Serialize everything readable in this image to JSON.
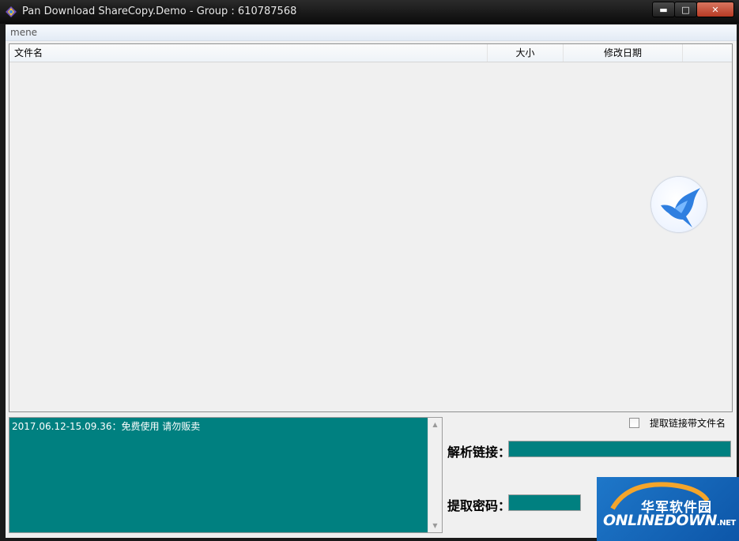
{
  "window": {
    "title": "Pan Download ShareCopy.Demo - Group : 610787568",
    "minimize_icon": "minimize-icon",
    "maximize_icon": "maximize-icon",
    "close_icon": "close-icon"
  },
  "menu": {
    "items": [
      "mene"
    ]
  },
  "file_list": {
    "columns": [
      "文件名",
      "大小",
      "修改日期"
    ],
    "rows": [],
    "logo_icon": "bird-logo-icon"
  },
  "log": {
    "lines": [
      "2017.06.12-15.09.36：免费使用 请勿贩卖"
    ]
  },
  "options": {
    "include_filename_label": "提取链接带文件名",
    "include_filename_checked": false
  },
  "form": {
    "parse_link_label": "解析链接：",
    "parse_link_value": "",
    "extract_code_label": "提取密码：",
    "extract_code_value": ""
  },
  "watermark": {
    "chinese": "华军软件园",
    "english": "ONLINEDOWN",
    "suffix": ".NET"
  },
  "colors": {
    "accent_teal": "#008080",
    "titlebar": "#111111"
  }
}
